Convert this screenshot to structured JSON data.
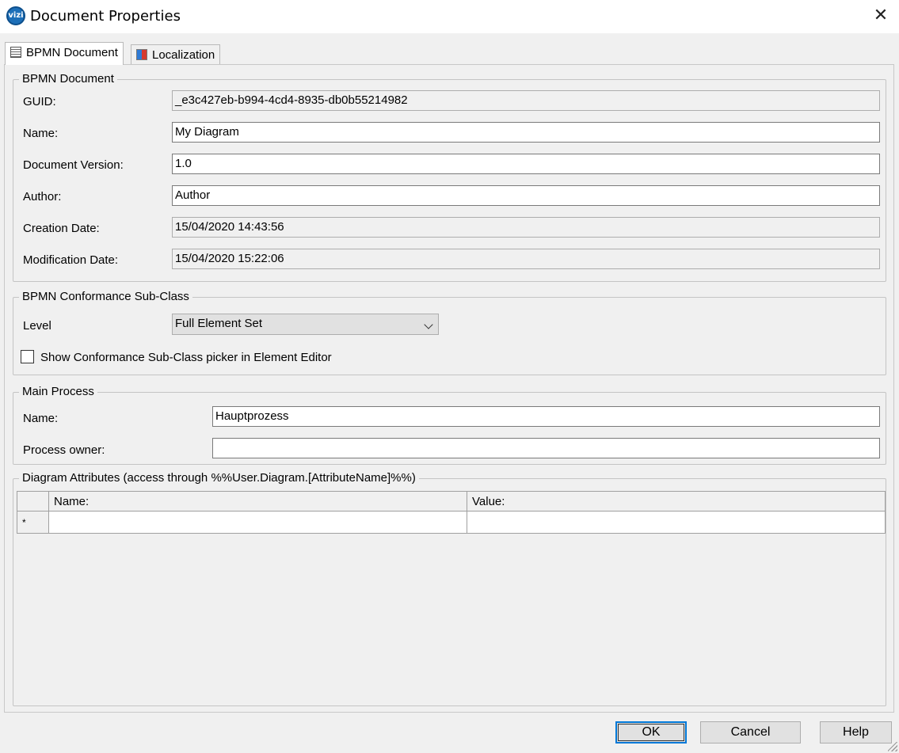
{
  "window": {
    "title": "Document Properties",
    "app_icon_text": "vizi",
    "close_glyph": "✕"
  },
  "tabs": [
    {
      "label": "BPMN Document",
      "icon": "document-icon",
      "active": true
    },
    {
      "label": "Localization",
      "icon": "localization-icon",
      "active": false
    }
  ],
  "bpmn_document": {
    "legend": "BPMN Document",
    "guid_label": "GUID:",
    "guid_value": "_e3c427eb-b994-4cd4-8935-db0b55214982",
    "name_label": "Name:",
    "name_value": "My Diagram",
    "version_label": "Document Version:",
    "version_value": "1.0",
    "author_label": "Author:",
    "author_value": "Author",
    "creation_label": "Creation Date:",
    "creation_value": "15/04/2020 14:43:56",
    "modification_label": "Modification Date:",
    "modification_value": "15/04/2020 15:22:06"
  },
  "conformance": {
    "legend": "BPMN Conformance Sub-Class",
    "level_label": "Level",
    "level_value": "Full Element Set",
    "checkbox_label": "Show Conformance Sub-Class picker in Element Editor",
    "checkbox_checked": false
  },
  "main_process": {
    "legend": "Main Process",
    "name_label": "Name:",
    "name_value": "Hauptprozess",
    "owner_label": "Process owner:",
    "owner_value": ""
  },
  "diagram_attributes": {
    "legend": "Diagram Attributes (access through %%User.Diagram.[AttributeName]%%)",
    "columns": [
      "Name:",
      "Value:"
    ],
    "new_row_marker": "*"
  },
  "buttons": {
    "ok": "OK",
    "cancel": "Cancel",
    "help": "Help"
  }
}
